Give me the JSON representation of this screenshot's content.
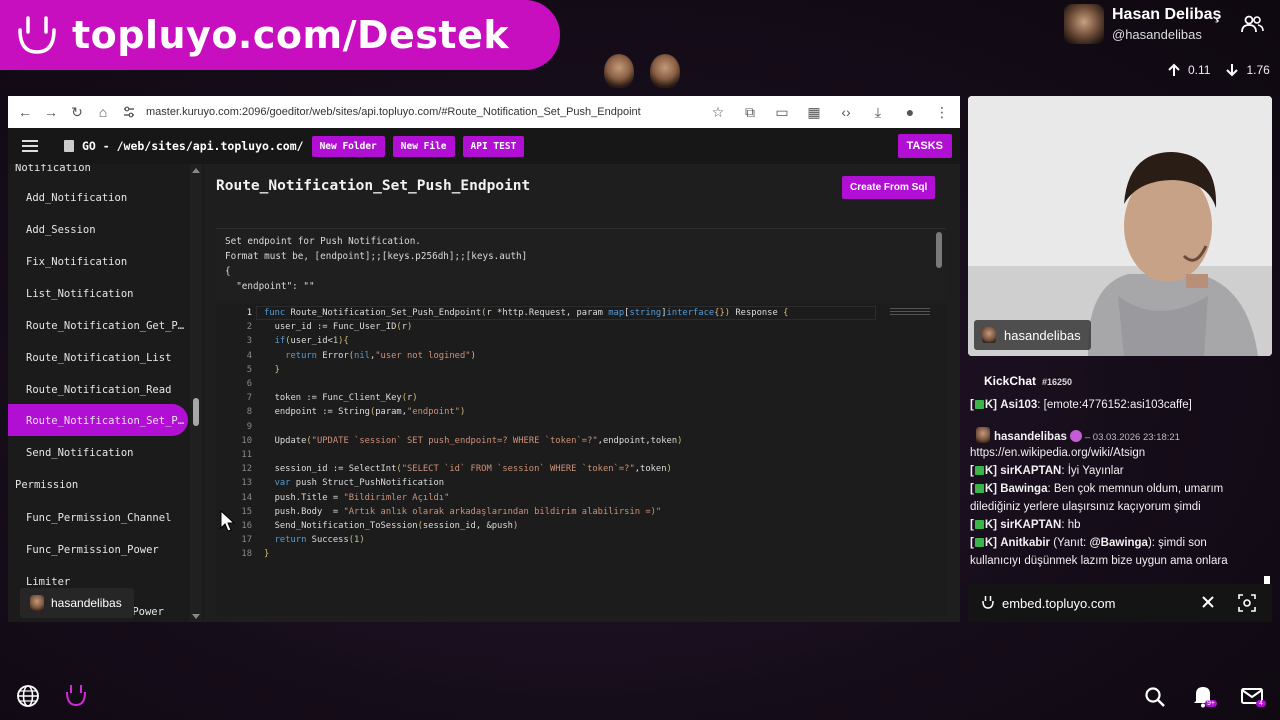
{
  "banner": {
    "text": "topluyo.com/Destek"
  },
  "profile": {
    "name": "Hasan Delibaş",
    "handle": "@hasandelibas"
  },
  "stats": {
    "up": "0.11",
    "down": "1.76"
  },
  "browser": {
    "url": "master.kuruyo.com:2096/goeditor/web/sites/api.topluyo.com/#Route_Notification_Set_Push_Endpoint"
  },
  "toolbar": {
    "path": "GO - /web/sites/api.topluyo.com/",
    "new_folder": "New Folder",
    "new_file": "New File",
    "api_test": "API TEST",
    "tasks": "TASKS"
  },
  "sidebar": {
    "group_notification": "Notification",
    "notification_items": [
      "Add_Notification",
      "Add_Session",
      "Fix_Notification",
      "List_Notification",
      "Route_Notification_Get_P…",
      "Route_Notification_List",
      "Route_Notification_Read",
      "Route_Notification_Set_P…",
      "Send_Notification"
    ],
    "group_permission": "Permission",
    "permission_items": [
      "Func_Permission_Channel",
      "Func_Permission_Power",
      "Limiter",
      "…Power"
    ]
  },
  "overlay_user": "hasandelibas",
  "editor": {
    "title": "Route_Notification_Set_Push_Endpoint",
    "create_sql": "Create From Sql",
    "comment_lines": [
      "Set endpoint for Push Notification.",
      "Format must be, [endpoint];;[keys.p256dh];;[keys.auth]",
      "{",
      "  \"endpoint\": \"\""
    ],
    "line_numbers": [
      "1",
      "2",
      "3",
      "4",
      "5",
      "6",
      "7",
      "8",
      "9",
      "10",
      "11",
      "12",
      "13",
      "14",
      "15",
      "16",
      "17",
      "18"
    ],
    "code_lines": [
      "func Route_Notification_Set_Push_Endpoint(r *http.Request, param map[string]interface{}) Response {",
      "  user_id := Func_User_ID(r)",
      "  if(user_id<1){",
      "    return Error(nil,\"user not logined\")",
      "  }",
      "",
      "  token := Func_Client_Key(r)",
      "  endpoint := String(param,\"endpoint\")",
      "",
      "  Update(\"UPDATE `session` SET push_endpoint=? WHERE `token`=?\",endpoint,token)",
      "",
      "  session_id := SelectInt(\"SELECT `id` FROM `session` WHERE `token`=?\",token)",
      "  var push Struct_PushNotification",
      "  push.Title = \"Bildirimler Açıldı\"",
      "  push.Body  = \"Artık anlık olarak arkadaşlarından bildirim alabilirsin =)\"",
      "  Send_Notification_ToSession(session_id, &push)",
      "  return Success(1)",
      "}"
    ]
  },
  "cam": {
    "label": "hasandelibas"
  },
  "chat": {
    "title": "KickChat",
    "id": "#16250",
    "messages": [
      {
        "prefix": "K]",
        "user": "Asi103",
        "text": ": [emote:4776152:asi103caffe]"
      },
      {
        "user": "hasandelibas",
        "time": "– 03.03.2026 23:18:21"
      },
      {
        "text": "https://en.wikipedia.org/wiki/Atsign"
      },
      {
        "prefix": "K]",
        "user": "sirKAPTAN",
        "text": ": İyi Yayınlar"
      },
      {
        "prefix": "K]",
        "user": "Bawinga",
        "text": ": Ben çok memnun oldum, umarım"
      },
      {
        "text": "dilediğiniz yerlere ulaşırsınız kaçıyorum şimdi"
      },
      {
        "prefix": "K]",
        "user": "sirKAPTAN",
        "text": ": hb"
      },
      {
        "prefix": "K]",
        "user": "Anitkabir",
        "reply_label": " (Yanıt: ",
        "reply_user": "@Bawinga",
        "text": "): şimdi son"
      },
      {
        "text": "kullanıcıyı düşünmek lazım bize uygun ama onlara"
      }
    ],
    "embed_url": "embed.topluyo.com"
  },
  "bottom": {
    "bell_badge": "9+",
    "mail_badge": "4"
  },
  "colors": {
    "accent": "#b20fd4",
    "banner": "#c80fbf",
    "editor_bg": "#1c1c1c"
  }
}
